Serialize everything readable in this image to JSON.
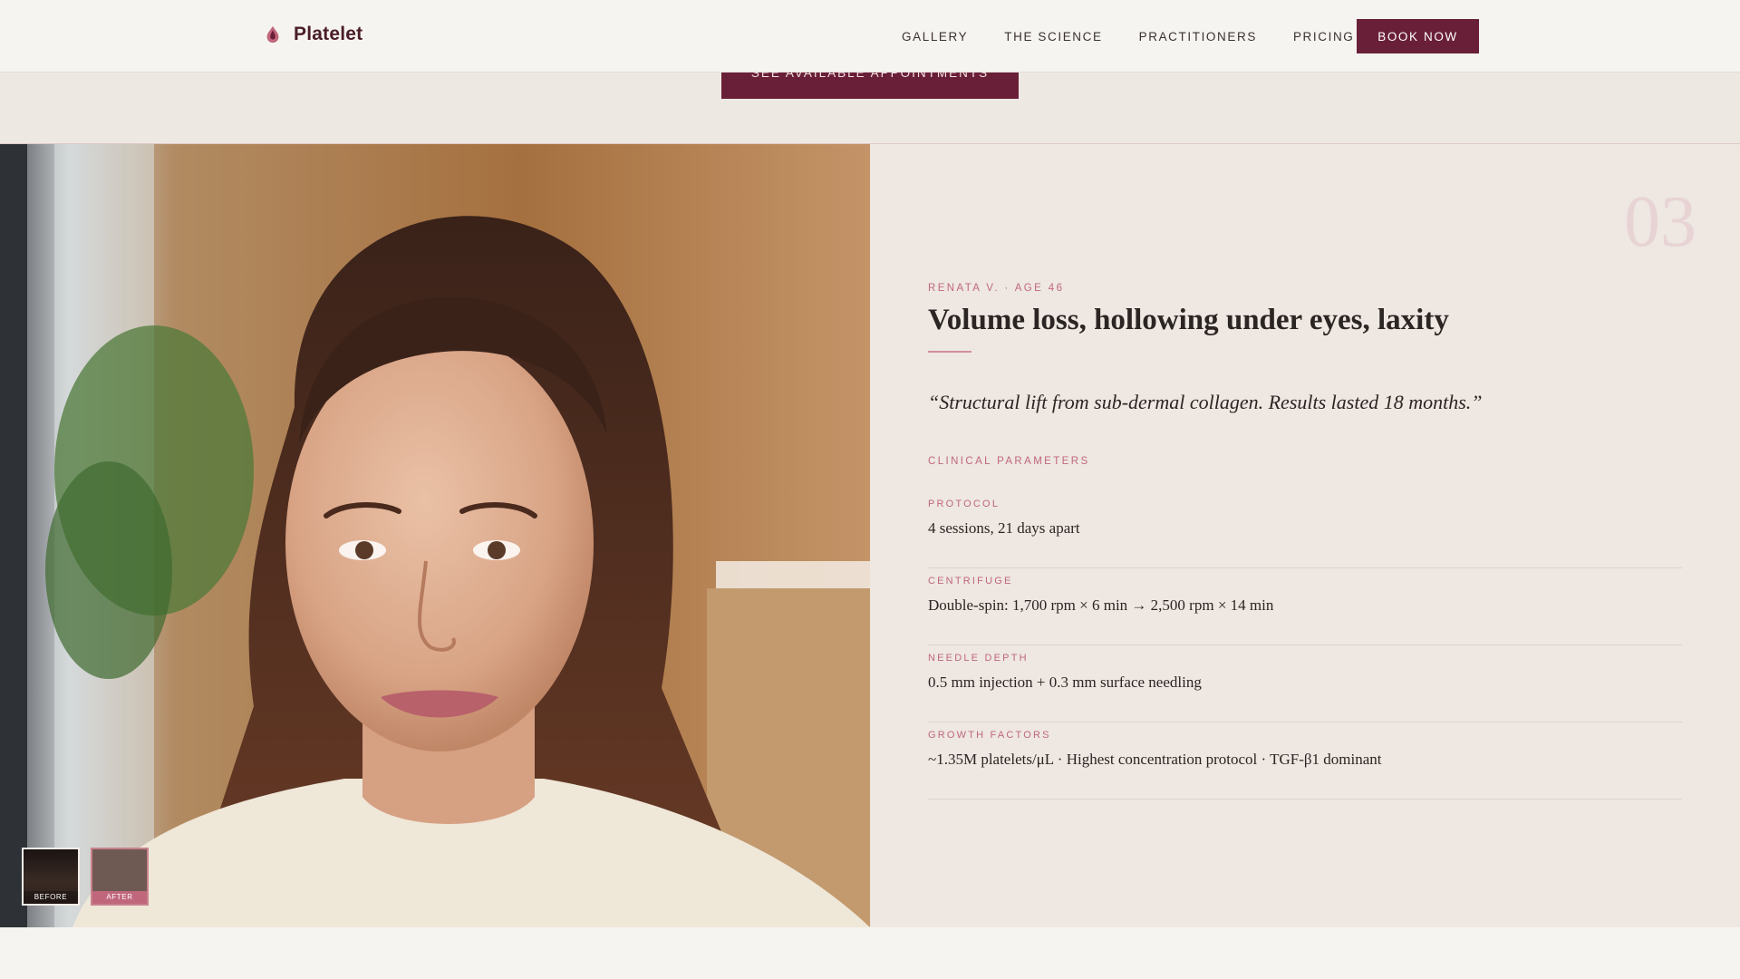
{
  "header": {
    "brand": "Platelet",
    "nav": [
      "GALLERY",
      "THE SCIENCE",
      "PRACTITIONERS",
      "PRICING"
    ],
    "cta": "BOOK NOW"
  },
  "strip": {
    "button": "SEE AVAILABLE APPOINTMENTS"
  },
  "photo": {
    "thumbs": [
      "BEFORE",
      "AFTER"
    ]
  },
  "case": {
    "number": "03",
    "patient": "RENATA V. · AGE 46",
    "title": "Volume loss, hollowing under eyes, laxity",
    "quote": "“Structural lift from sub-dermal collagen. Results lasted 18 months.”",
    "params_heading": "CLINICAL PARAMETERS",
    "params": [
      {
        "label": "PROTOCOL",
        "value": "4 sessions, 21 days apart"
      },
      {
        "label": "CENTRIFUGE",
        "value": "Double-spin: 1,700 rpm × 6 min → 2,500 rpm × 14 min"
      },
      {
        "label": "NEEDLE DEPTH",
        "value": "0.5 mm injection + 0.3 mm surface needling"
      },
      {
        "label": "GROWTH FACTORS",
        "value": "~1.35M platelets/μL · Highest concentration protocol · TGF-β1 dominant"
      }
    ]
  },
  "colors": {
    "brand": "#6a1f38",
    "accent": "#c0677c",
    "background": "#eee7e2"
  }
}
